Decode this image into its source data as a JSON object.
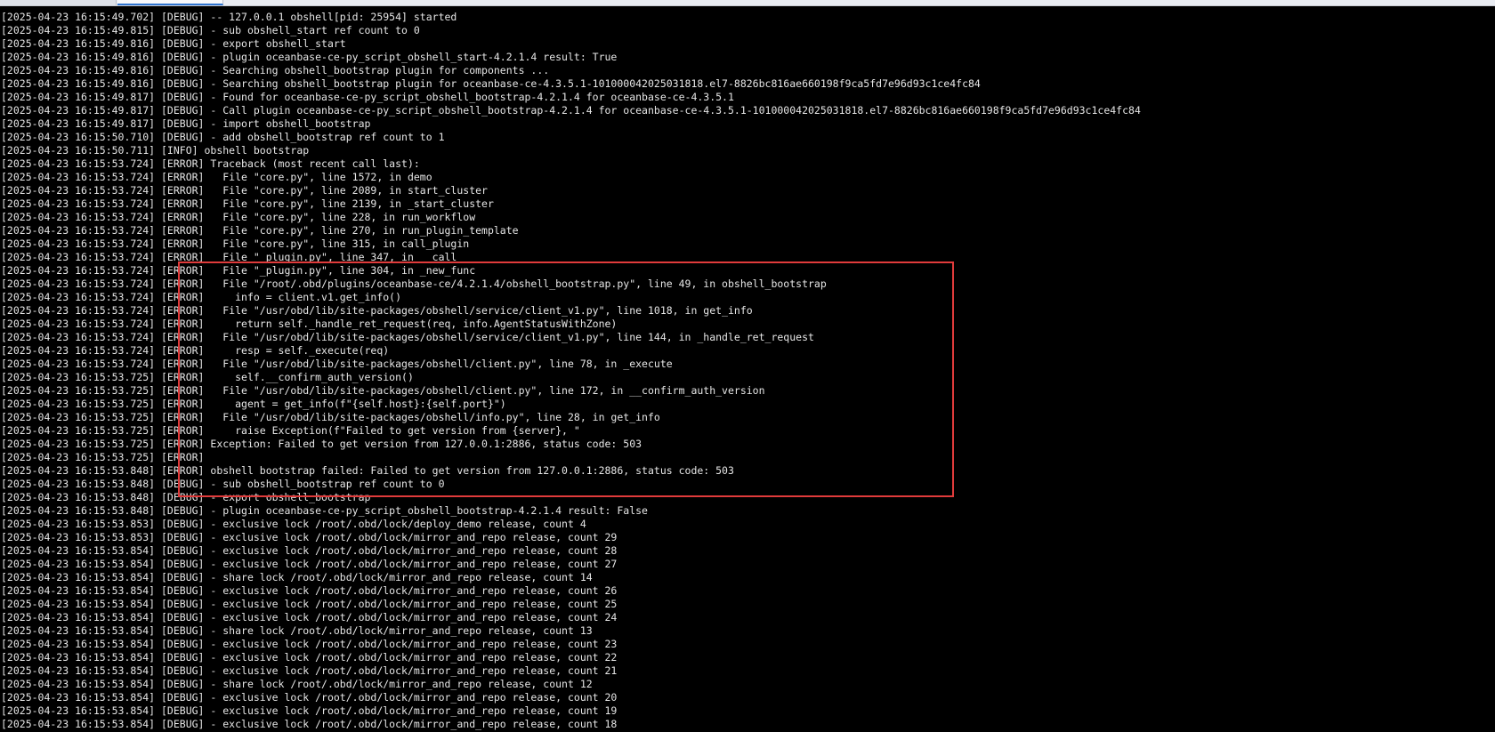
{
  "window": {
    "tabs": [
      "",
      ""
    ]
  },
  "annotation": {
    "color": "#e03b3b"
  },
  "log_lines": [
    "[2025-04-23 16:15:49.702] [DEBUG] -- 127.0.0.1 obshell[pid: 25954] started",
    "[2025-04-23 16:15:49.815] [DEBUG] - sub obshell_start ref count to 0",
    "[2025-04-23 16:15:49.816] [DEBUG] - export obshell_start",
    "[2025-04-23 16:15:49.816] [DEBUG] - plugin oceanbase-ce-py_script_obshell_start-4.2.1.4 result: True",
    "[2025-04-23 16:15:49.816] [DEBUG] - Searching obshell_bootstrap plugin for components ...",
    "[2025-04-23 16:15:49.816] [DEBUG] - Searching obshell_bootstrap plugin for oceanbase-ce-4.3.5.1-101000042025031818.el7-8826bc816ae660198f9ca5fd7e96d93c1ce4fc84",
    "[2025-04-23 16:15:49.817] [DEBUG] - Found for oceanbase-ce-py_script_obshell_bootstrap-4.2.1.4 for oceanbase-ce-4.3.5.1",
    "[2025-04-23 16:15:49.817] [DEBUG] - Call plugin oceanbase-ce-py_script_obshell_bootstrap-4.2.1.4 for oceanbase-ce-4.3.5.1-101000042025031818.el7-8826bc816ae660198f9ca5fd7e96d93c1ce4fc84",
    "[2025-04-23 16:15:49.817] [DEBUG] - import obshell_bootstrap",
    "[2025-04-23 16:15:50.710] [DEBUG] - add obshell_bootstrap ref count to 1",
    "[2025-04-23 16:15:50.711] [INFO] obshell bootstrap",
    "[2025-04-23 16:15:53.724] [ERROR] Traceback (most recent call last):",
    "[2025-04-23 16:15:53.724] [ERROR]   File \"core.py\", line 1572, in demo",
    "[2025-04-23 16:15:53.724] [ERROR]   File \"core.py\", line 2089, in start_cluster",
    "[2025-04-23 16:15:53.724] [ERROR]   File \"core.py\", line 2139, in _start_cluster",
    "[2025-04-23 16:15:53.724] [ERROR]   File \"core.py\", line 228, in run_workflow",
    "[2025-04-23 16:15:53.724] [ERROR]   File \"core.py\", line 270, in run_plugin_template",
    "[2025-04-23 16:15:53.724] [ERROR]   File \"core.py\", line 315, in call_plugin",
    "[2025-04-23 16:15:53.724] [ERROR]   File \"_plugin.py\", line 347, in __call__",
    "[2025-04-23 16:15:53.724] [ERROR]   File \"_plugin.py\", line 304, in _new_func",
    "[2025-04-23 16:15:53.724] [ERROR]   File \"/root/.obd/plugins/oceanbase-ce/4.2.1.4/obshell_bootstrap.py\", line 49, in obshell_bootstrap",
    "[2025-04-23 16:15:53.724] [ERROR]     info = client.v1.get_info()",
    "[2025-04-23 16:15:53.724] [ERROR]   File \"/usr/obd/lib/site-packages/obshell/service/client_v1.py\", line 1018, in get_info",
    "[2025-04-23 16:15:53.724] [ERROR]     return self._handle_ret_request(req, info.AgentStatusWithZone)",
    "[2025-04-23 16:15:53.724] [ERROR]   File \"/usr/obd/lib/site-packages/obshell/service/client_v1.py\", line 144, in _handle_ret_request",
    "[2025-04-23 16:15:53.724] [ERROR]     resp = self._execute(req)",
    "[2025-04-23 16:15:53.724] [ERROR]   File \"/usr/obd/lib/site-packages/obshell/client.py\", line 78, in _execute",
    "[2025-04-23 16:15:53.725] [ERROR]     self.__confirm_auth_version()",
    "[2025-04-23 16:15:53.725] [ERROR]   File \"/usr/obd/lib/site-packages/obshell/client.py\", line 172, in __confirm_auth_version",
    "[2025-04-23 16:15:53.725] [ERROR]     agent = get_info(f\"{self.host}:{self.port}\")",
    "[2025-04-23 16:15:53.725] [ERROR]   File \"/usr/obd/lib/site-packages/obshell/info.py\", line 28, in get_info",
    "[2025-04-23 16:15:53.725] [ERROR]     raise Exception(f\"Failed to get version from {server}, \"",
    "[2025-04-23 16:15:53.725] [ERROR] Exception: Failed to get version from 127.0.0.1:2886, status code: 503",
    "[2025-04-23 16:15:53.725] [ERROR]",
    "[2025-04-23 16:15:53.848] [ERROR] obshell bootstrap failed: Failed to get version from 127.0.0.1:2886, status code: 503",
    "[2025-04-23 16:15:53.848] [DEBUG] - sub obshell_bootstrap ref count to 0",
    "[2025-04-23 16:15:53.848] [DEBUG] - export obshell_bootstrap",
    "[2025-04-23 16:15:53.848] [DEBUG] - plugin oceanbase-ce-py_script_obshell_bootstrap-4.2.1.4 result: False",
    "[2025-04-23 16:15:53.853] [DEBUG] - exclusive lock /root/.obd/lock/deploy_demo release, count 4",
    "[2025-04-23 16:15:53.853] [DEBUG] - exclusive lock /root/.obd/lock/mirror_and_repo release, count 29",
    "[2025-04-23 16:15:53.854] [DEBUG] - exclusive lock /root/.obd/lock/mirror_and_repo release, count 28",
    "[2025-04-23 16:15:53.854] [DEBUG] - exclusive lock /root/.obd/lock/mirror_and_repo release, count 27",
    "[2025-04-23 16:15:53.854] [DEBUG] - share lock /root/.obd/lock/mirror_and_repo release, count 14",
    "[2025-04-23 16:15:53.854] [DEBUG] - exclusive lock /root/.obd/lock/mirror_and_repo release, count 26",
    "[2025-04-23 16:15:53.854] [DEBUG] - exclusive lock /root/.obd/lock/mirror_and_repo release, count 25",
    "[2025-04-23 16:15:53.854] [DEBUG] - exclusive lock /root/.obd/lock/mirror_and_repo release, count 24",
    "[2025-04-23 16:15:53.854] [DEBUG] - share lock /root/.obd/lock/mirror_and_repo release, count 13",
    "[2025-04-23 16:15:53.854] [DEBUG] - exclusive lock /root/.obd/lock/mirror_and_repo release, count 23",
    "[2025-04-23 16:15:53.854] [DEBUG] - exclusive lock /root/.obd/lock/mirror_and_repo release, count 22",
    "[2025-04-23 16:15:53.854] [DEBUG] - exclusive lock /root/.obd/lock/mirror_and_repo release, count 21",
    "[2025-04-23 16:15:53.854] [DEBUG] - share lock /root/.obd/lock/mirror_and_repo release, count 12",
    "[2025-04-23 16:15:53.854] [DEBUG] - exclusive lock /root/.obd/lock/mirror_and_repo release, count 20",
    "[2025-04-23 16:15:53.854] [DEBUG] - exclusive lock /root/.obd/lock/mirror_and_repo release, count 19",
    "[2025-04-23 16:15:53.854] [DEBUG] - exclusive lock /root/.obd/lock/mirror_and_repo release, count 18"
  ]
}
